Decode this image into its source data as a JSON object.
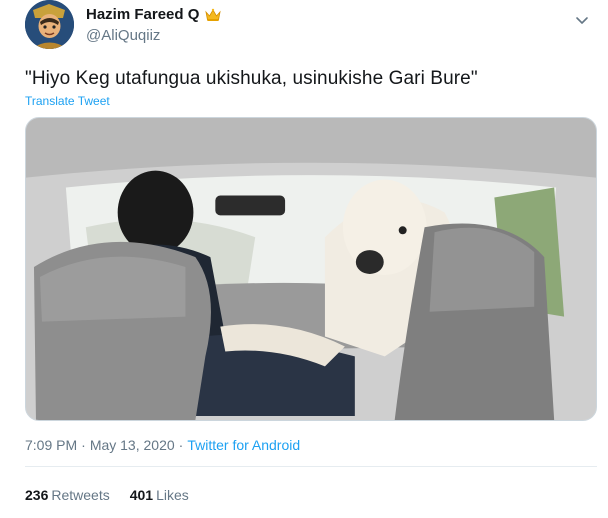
{
  "user": {
    "display_name": "Hazim Fareed Q",
    "handle": "@AliQuqiiz"
  },
  "tweet": {
    "text": "\"Hiyo Keg utafungua ukishuka, usinukishe Gari Bure\"",
    "translate_label": "Translate Tweet"
  },
  "meta": {
    "time": "7:09 PM",
    "separator1": "·",
    "date": "May 13, 2020",
    "separator2": "·",
    "source": "Twitter for Android"
  },
  "stats": {
    "retweets_count": "236",
    "retweets_label": "Retweets",
    "likes_count": "401",
    "likes_label": "Likes"
  },
  "icons": {
    "badge": "crown-icon",
    "menu": "chevron-down-icon"
  }
}
